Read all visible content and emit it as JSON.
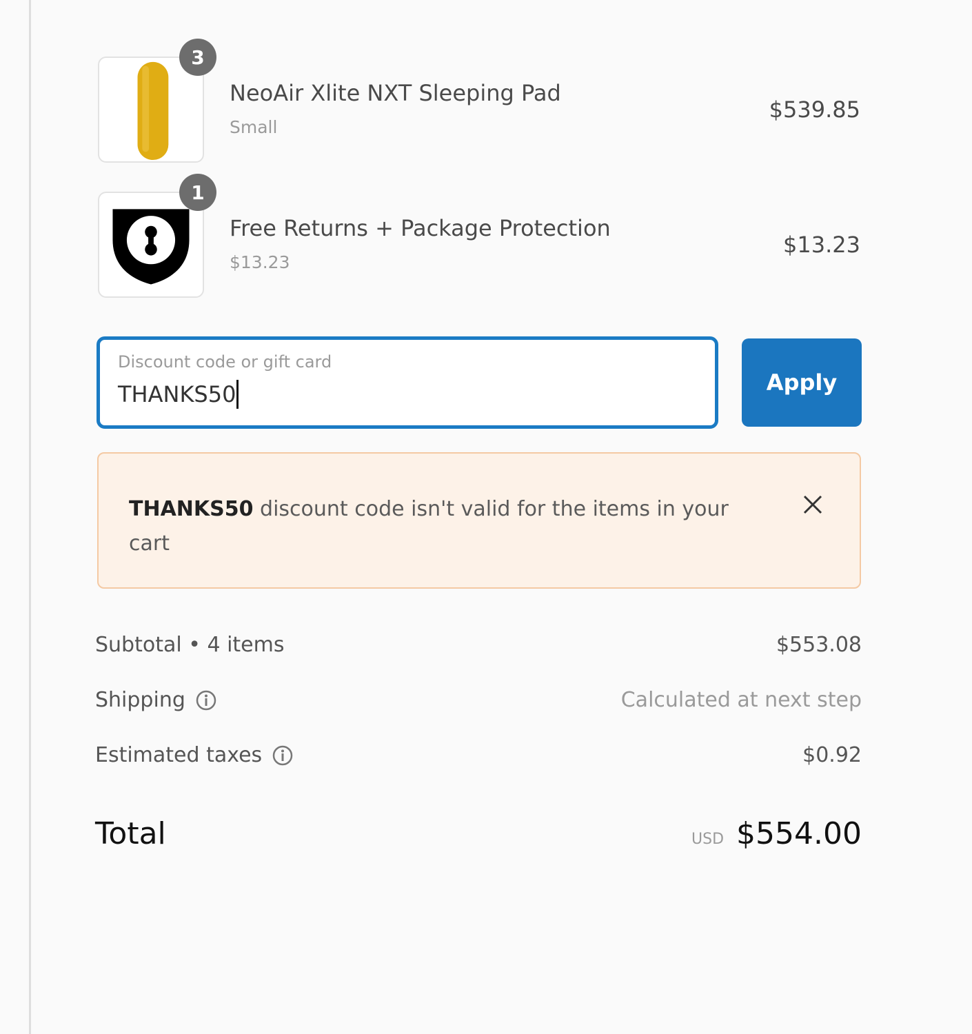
{
  "line_items": [
    {
      "quantity": "3",
      "name": "NeoAir Xlite NXT Sleeping Pad",
      "variant": "Small",
      "price": "$539.85",
      "thumbnail_icon": "sleeping-pad-icon",
      "thumbnail_color": "#e0ad14"
    },
    {
      "quantity": "1",
      "name": "Free Returns + Package Protection",
      "variant": "$13.23",
      "price": "$13.23",
      "thumbnail_icon": "shield-lock-icon",
      "thumbnail_color": "#000000"
    }
  ],
  "discount": {
    "label": "Discount code or gift card",
    "value": "THANKS50",
    "apply_label": "Apply",
    "accent_color": "#1b76bf"
  },
  "error": {
    "code": "THANKS50",
    "message": " discount code isn't valid for the items in your cart",
    "background": "#fdf2e8",
    "border": "#f4c9a3"
  },
  "summary": {
    "subtotal_label": "Subtotal • 4 items",
    "subtotal_value": "$553.08",
    "shipping_label": "Shipping",
    "shipping_value": "Calculated at next step",
    "taxes_label": "Estimated taxes",
    "taxes_value": "$0.92",
    "total_label": "Total",
    "currency": "USD",
    "total_value": "$554.00"
  }
}
